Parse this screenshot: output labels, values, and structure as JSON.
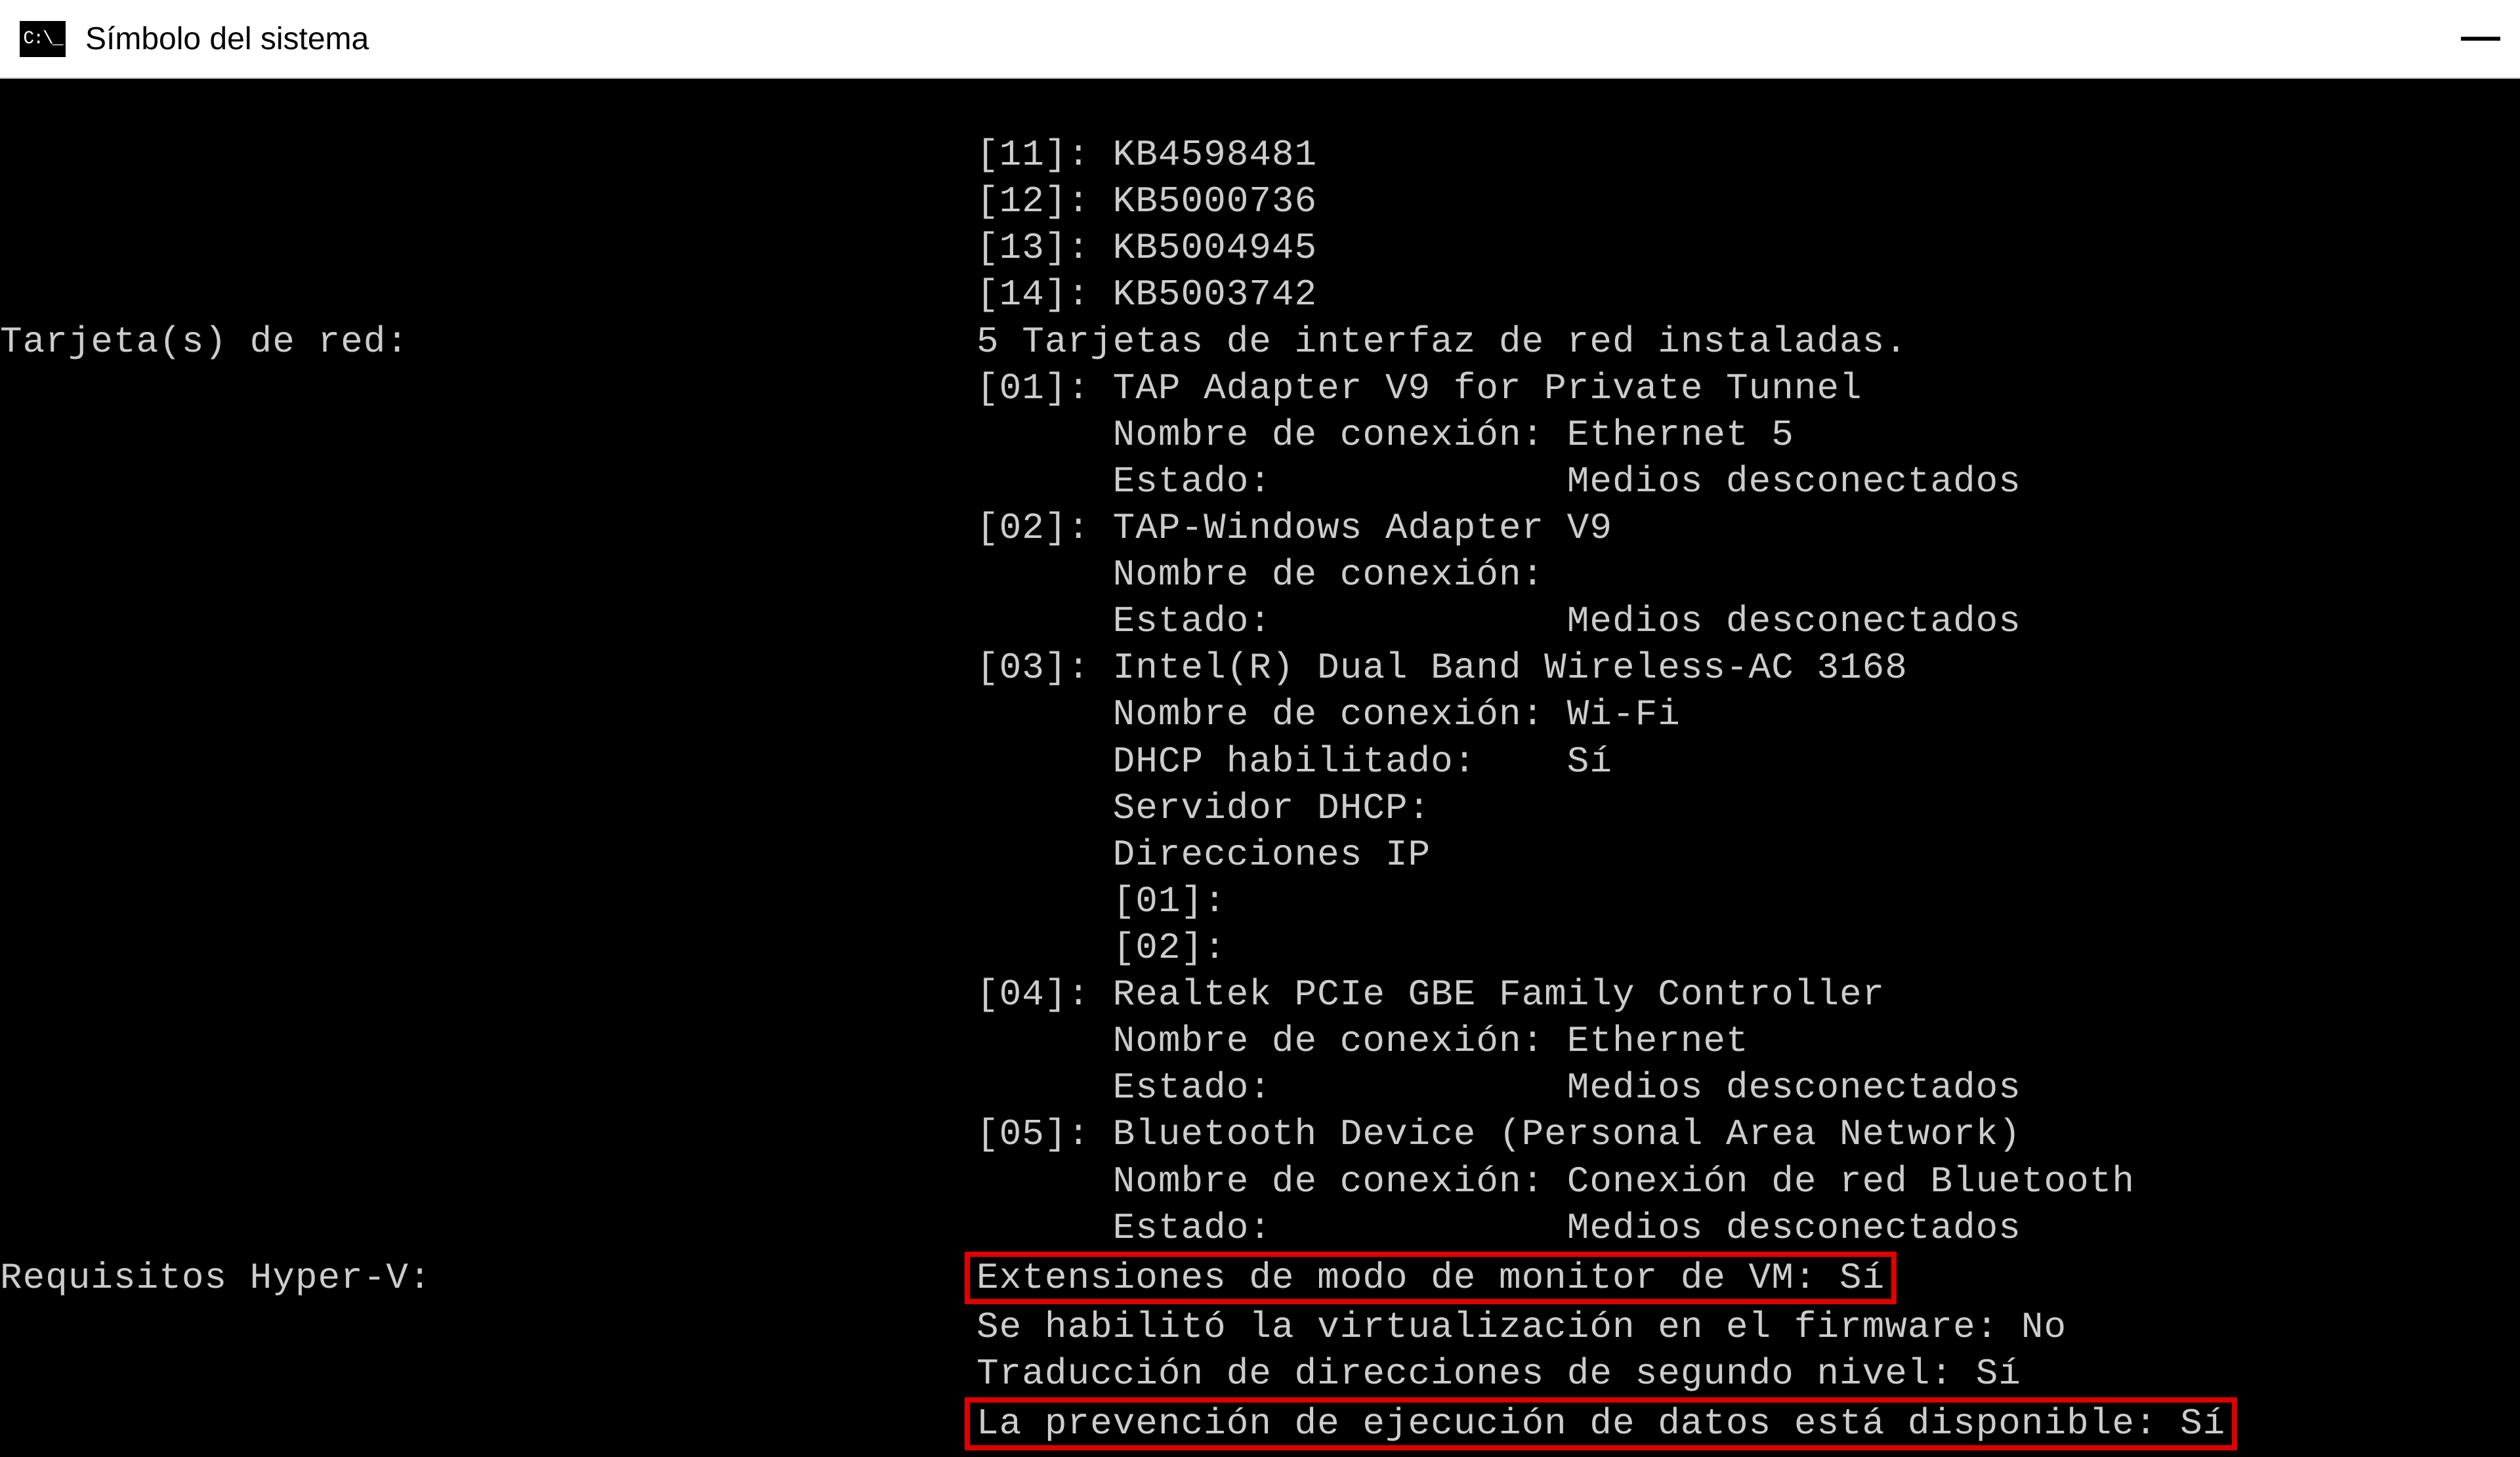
{
  "window": {
    "title": "Símbolo del sistema"
  },
  "hotfixes": {
    "h11": "[11]: KB4598481",
    "h12": "[12]: KB5000736",
    "h13": "[13]: KB5004945",
    "h14": "[14]: KB5003742"
  },
  "network": {
    "label": "Tarjeta(s) de red:",
    "summary": "5 Tarjetas de interfaz de red instaladas.",
    "adapters": {
      "a01": {
        "header": "[01]: TAP Adapter V9 for Private Tunnel",
        "connname": "Nombre de conexión: Ethernet 5",
        "state": "Estado:             Medios desconectados"
      },
      "a02": {
        "header": "[02]: TAP-Windows Adapter V9",
        "connname": "Nombre de conexión:",
        "state": "Estado:             Medios desconectados"
      },
      "a03": {
        "header": "[03]: Intel(R) Dual Band Wireless-AC 3168",
        "connname": "Nombre de conexión: Wi-Fi",
        "dhcp": "DHCP habilitado:    Sí",
        "dhcpserver": "Servidor DHCP:",
        "ipaddr": "Direcciones IP",
        "ip01": "[01]:",
        "ip02": "[02]:"
      },
      "a04": {
        "header": "[04]: Realtek PCIe GBE Family Controller",
        "connname": "Nombre de conexión: Ethernet",
        "state": "Estado:             Medios desconectados"
      },
      "a05": {
        "header": "[05]: Bluetooth Device (Personal Area Network)",
        "connname": "Nombre de conexión: Conexión de red Bluetooth",
        "state": "Estado:             Medios desconectados"
      }
    }
  },
  "hyperv": {
    "label": "Requisitos Hyper-V:",
    "ext": "Extensiones de modo de monitor de VM: Sí",
    "virt": "Se habilitó la virtualización en el firmware: No",
    "slat": "Traducción de direcciones de segundo nivel: Sí",
    "dep": "La prevención de ejecución de datos está disponible: Sí"
  }
}
